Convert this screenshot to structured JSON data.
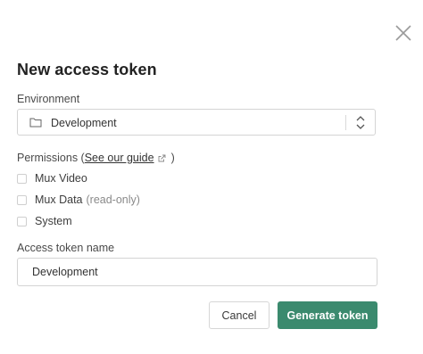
{
  "dialog": {
    "title": "New access token",
    "close_icon": "close-icon"
  },
  "environment": {
    "label": "Environment",
    "selected": "Development",
    "icon": "folder-icon"
  },
  "permissions": {
    "label_prefix": "Permissions (",
    "guide_link": "See our guide",
    "label_suffix": ")",
    "items": [
      {
        "label": "Mux Video",
        "note": "",
        "checked": false
      },
      {
        "label": "Mux Data",
        "note": "(read-only)",
        "checked": false
      },
      {
        "label": "System",
        "note": "",
        "checked": false
      }
    ]
  },
  "token_name": {
    "label": "Access token name",
    "value": "Development"
  },
  "actions": {
    "cancel_label": "Cancel",
    "generate_label": "Generate token",
    "generate_color": "#3b8a6e"
  }
}
